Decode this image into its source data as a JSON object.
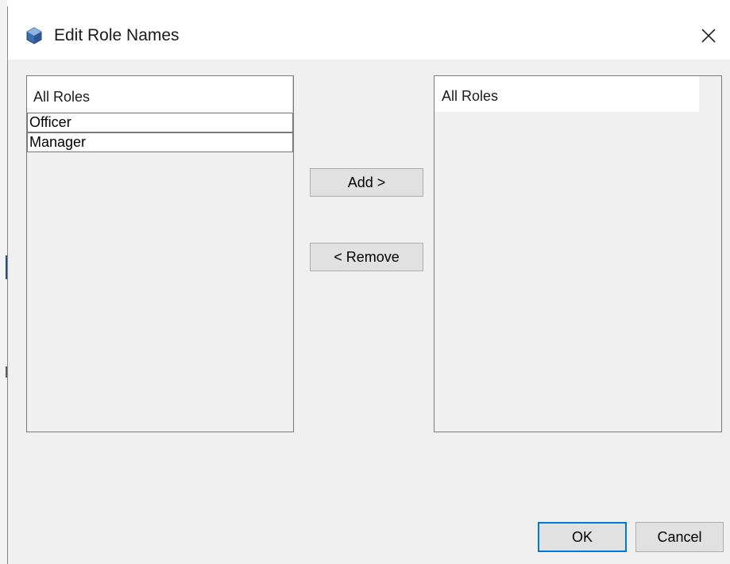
{
  "dialog": {
    "title": "Edit Role Names",
    "title_icon": "cube-icon",
    "close_icon": "close-icon"
  },
  "available_list": {
    "header": "All Roles",
    "items": [
      "Officer",
      "Manager"
    ]
  },
  "selected_list": {
    "header": "All Roles",
    "items": []
  },
  "buttons": {
    "add": "Add >",
    "remove": "< Remove",
    "ok": "OK",
    "cancel": "Cancel"
  },
  "colors": {
    "dialog_background": "#f0f0f0",
    "title_background": "#ffffff",
    "button_background": "#e1e1e1",
    "default_button_border": "#0078d7",
    "title_icon": "#2b5797"
  }
}
